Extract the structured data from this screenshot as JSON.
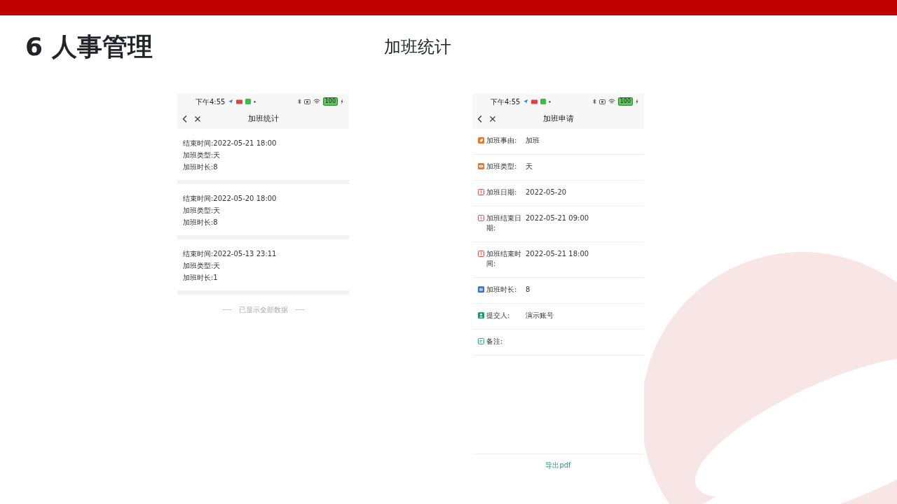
{
  "slide": {
    "title": "6 人事管理",
    "subtitle": "加班统计"
  },
  "phones": [
    {
      "status_bar": {
        "time": "下午4:55",
        "battery_text": "100"
      },
      "nav_title": "加班统计",
      "records": [
        {
          "lines": [
            "结束时间:2022-05-21 18:00",
            "加班类型:天",
            "加班时长:8"
          ]
        },
        {
          "lines": [
            "结束时间:2022-05-20 18:00",
            "加班类型:天",
            "加班时长:8"
          ]
        },
        {
          "lines": [
            "结束时间:2022-05-13 23:11",
            "加班类型:天",
            "加班时长:1"
          ]
        }
      ],
      "end_note": "已显示全部数据"
    },
    {
      "status_bar": {
        "time": "下午4:55",
        "battery_text": "100"
      },
      "nav_title": "加班申请",
      "fields": [
        {
          "kind": "tag",
          "color": "#e8772e",
          "label": "加班事由:",
          "value": "加班"
        },
        {
          "kind": "eye",
          "color": "#e8772e",
          "label": "加班类型:",
          "value": "天"
        },
        {
          "kind": "calendar",
          "color": "#d9534f",
          "label": "加班日期:",
          "value": "2022-05-20"
        },
        {
          "kind": "calendar",
          "color": "#d9534f",
          "label": "加班结束日期:",
          "value": "2022-05-21 09:00"
        },
        {
          "kind": "calendar",
          "color": "#d9534f",
          "label": "加班结束时间:",
          "value": "2022-05-21 18:00"
        },
        {
          "kind": "hash",
          "color": "#3b6fd8",
          "label": "加班时长:",
          "value": "8"
        },
        {
          "kind": "person",
          "color": "#1a9a6c",
          "label": "提交人:",
          "value": "演示账号"
        },
        {
          "kind": "note",
          "color": "#2aa37a",
          "label": "备注:"
        }
      ],
      "footer_button": "导出pdf"
    }
  ]
}
